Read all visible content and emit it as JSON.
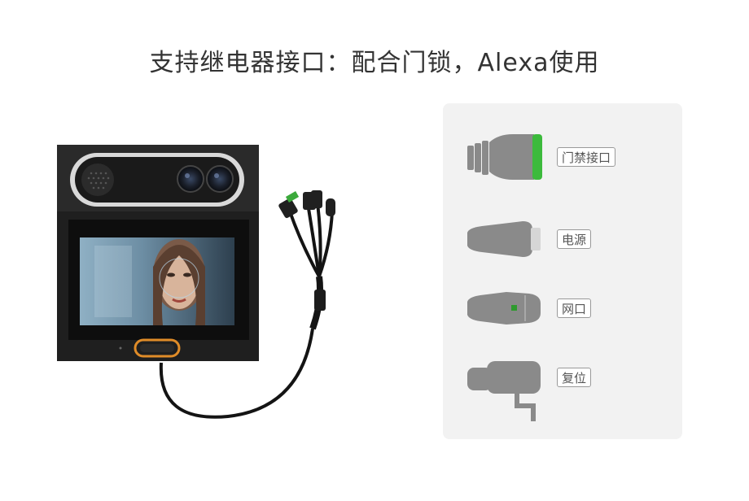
{
  "title": "支持继电器接口：配合门锁，Alexa使用",
  "colors": {
    "connector_gray": "#8a8a8a",
    "door_access_accent": "#3cba3c",
    "network_led": "#2e9a2e",
    "panel_bg": "#f2f2f2"
  },
  "connectors": [
    {
      "id": "door-access",
      "label": "门禁接口",
      "icon": "door-access-connector-icon"
    },
    {
      "id": "power",
      "label": "电源",
      "icon": "power-connector-icon"
    },
    {
      "id": "network",
      "label": "网口",
      "icon": "network-connector-icon"
    },
    {
      "id": "reset",
      "label": "复位",
      "icon": "reset-connector-icon"
    }
  ],
  "device": {
    "icon": "face-recognition-terminal-image"
  }
}
